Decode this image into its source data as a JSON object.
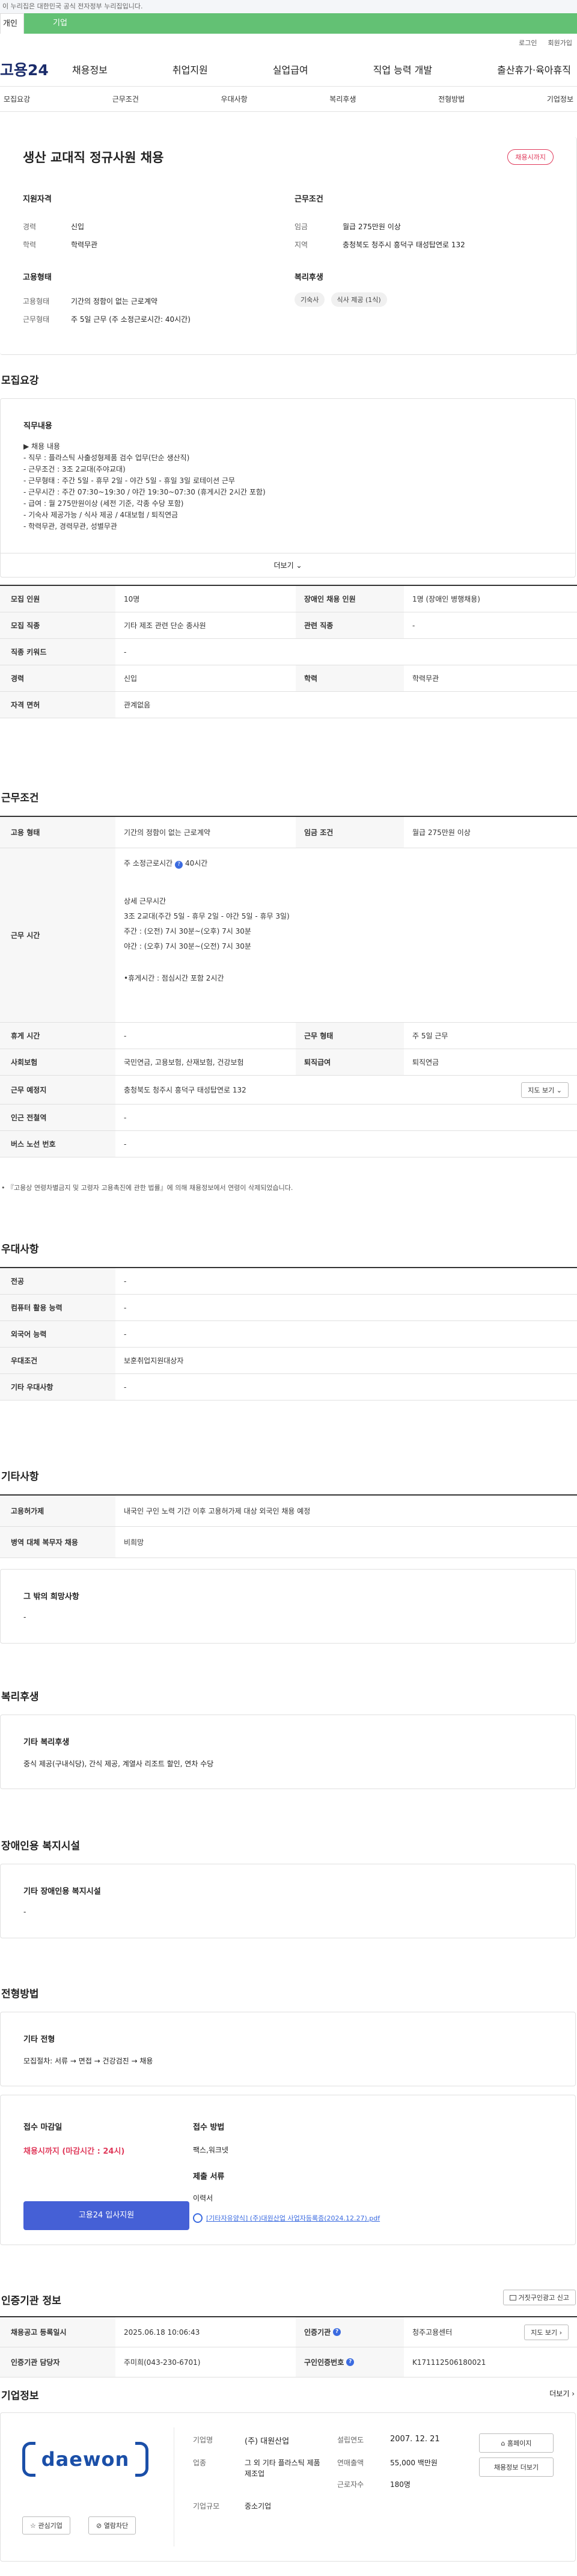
{
  "gov_banner": "이 누리집은 대한민국 공식 전자정부 누리집입니다.",
  "tabs": {
    "person": "개인",
    "company": "기업"
  },
  "util": {
    "login": "로그인",
    "join": "회원가입"
  },
  "logo": "고용24",
  "gnb": [
    "채용정보",
    "취업지원",
    "실업급여",
    "직업 능력 개발",
    "출산휴가·육아휴직"
  ],
  "subnav": [
    "모집요강",
    "근무조건",
    "우대사항",
    "복리후생",
    "전형방법",
    "기업정보"
  ],
  "summary": {
    "title": "생산 교대직 정규사원 채용",
    "badge": "채용시까지",
    "qualification_h": "지원자격",
    "career_l": "경력",
    "career_v": "신입",
    "edu_l": "학력",
    "edu_v": "학력무관",
    "emptype_h": "고용형태",
    "emptype_l": "고용형태",
    "emptype_v": "기간의 정함이 없는 근로계약",
    "worktype_l": "근무형태",
    "worktype_v": "주 5일 근무 (주 소정근로시간: 40시간)",
    "cond_h": "근무조건",
    "wage_l": "임금",
    "wage_v": "월급 275만원 이상",
    "region_l": "지역",
    "region_v": "충청북도 청주시 흥덕구 태성탑연로 132",
    "welfare_h": "복리후생",
    "welfare_pills": [
      "기숙사",
      "식사 제공 (1식)"
    ]
  },
  "req": {
    "heading": "모집요강",
    "job_h": "직무내용",
    "job_lines": [
      "▶ 채용 내용",
      "- 직무 : 플라스틱 사출성형제품 검수 업무(단순 생산직)",
      "- 근무조건 : 3조 2교대(주야교대)",
      "- 근무형태 : 주간 5일 - 휴무 2일 - 야간 5일 - 휴일 3일 로테이션 근무",
      "- 근무시간 : 주간 07:30~19:30 / 야간 19:30~07:30 (휴게시간 2시간 포함)",
      "- 급여 : 월 275만원이상 (세전 기준, 각종 수당 포함)",
      "- 기숙사 제공가능 / 식사 제공 / 4대보험 / 퇴직연금",
      "- 학력무관, 경력무관, 성별무관"
    ],
    "more": "더보기",
    "rows": [
      {
        "l1": "모집 인원",
        "v1": "10명",
        "l2": "장애인 채용 인원",
        "v2": "1명 (장애인 병행채용)"
      },
      {
        "l1": "모집 직종",
        "v1": "기타 제조 관련 단순 종사원",
        "l2": "관련 직종",
        "v2": "-"
      },
      {
        "l1": "직종 키워드",
        "v1": "-"
      },
      {
        "l1": "경력",
        "v1": "신입",
        "l2": "학력",
        "v2": "학력무관"
      },
      {
        "l1": "자격 면허",
        "v1": "관계없음"
      }
    ]
  },
  "work": {
    "heading": "근무조건",
    "emptype_l": "고용 형태",
    "emptype_v": "기간의 정함이 없는 근로계약",
    "wage_l": "임금 조건",
    "wage_v": "월급 275만원 이상",
    "time_l": "근무 시간",
    "time_lines": [
      "주 소정근로시간",
      "40시간",
      "상세 근무시간",
      "3조 2교대(주간 5일 - 휴무 2일 - 야간 5일 - 휴무 3일)",
      "주간 : (오전) 7시 30분~(오후) 7시 30분",
      "야간 : (오후) 7시 30분~(오전) 7시 30분",
      "•휴게시간 : 점심시간 포함 2시간"
    ],
    "rest_l": "휴게 시간",
    "rest_v": "-",
    "form_l": "근무 형태",
    "form_v": "주 5일 근무",
    "ins_l": "사회보험",
    "ins_v": "국민연금, 고용보험, 산재보험, 건강보험",
    "ret_l": "퇴직급여",
    "ret_v": "퇴직연금",
    "place_l": "근무 예정지",
    "place_v": "충청북도 청주시 흥덕구 태성탑연로 132",
    "map_btn": "지도 보기",
    "subway_l": "인근 전철역",
    "subway_v": "-",
    "bus_l": "버스 노선 번호",
    "bus_v": "-",
    "note": "• 『고용상 연령차별금지 및 고령자 고용촉진에 관한 법률』에 의해 채용정보에서 연령이 삭제되었습니다."
  },
  "pref": {
    "heading": "우대사항",
    "rows": [
      {
        "l": "전공",
        "v": "-"
      },
      {
        "l": "컴퓨터 활용 능력",
        "v": "-"
      },
      {
        "l": "외국어 능력",
        "v": "-"
      },
      {
        "l": "우대조건",
        "v": "보훈취업지원대상자"
      },
      {
        "l": "기타 우대사항",
        "v": "-"
      }
    ]
  },
  "etc": {
    "heading": "기타사항",
    "r1_l": "고용허가제",
    "r1_v": "내국인 구인 노력 기간 이후 고용허가제 대상 외국인 채용 예정",
    "r2_l": "병역 대체 복무자 채용",
    "r2_v": "비희망",
    "other_h": "그 밖의 희망사항",
    "other_v": "-"
  },
  "welfare": {
    "heading": "복리후생",
    "sub": "기타 복리후생",
    "text": "중식 제공(구내식당), 간식 제공, 계열사 리조트 할인, 연차 수당"
  },
  "disab": {
    "heading": "장애인용 복지시설",
    "sub": "기타 장애인용 복지시설",
    "text": "-"
  },
  "select": {
    "heading": "전형방법",
    "sub": "기타 전형",
    "text": "모집절차: 서류 → 면접 → 건강검진 → 채용",
    "deadline_h": "접수 마감일",
    "deadline_v": "채용시까지 (마감시간 : 24시)",
    "apply_btn": "고용24 입사지원",
    "method_h": "접수 방법",
    "method_v": "팩스,워크넷",
    "docs_h": "제출 서류",
    "docs_v": "이력서",
    "file": "[기타자유양식] (주)대원산업 사업자등록증(2024.12.27).pdf"
  },
  "agency": {
    "heading": "인증기관 정보",
    "report_btn": "거짓구인광고 신고",
    "r1_l1": "채용공고 등록일시",
    "r1_v1": "2025.06.18 10:06:43",
    "r1_l2": "인증기관",
    "r1_v2": "청주고용센터",
    "map_btn": "지도 보기",
    "r2_l1": "인증기관 담당자",
    "r2_v1": "주미희(043-230-6701)",
    "r2_l2": "구인인증번호",
    "r2_v2": "K171112506180021"
  },
  "company": {
    "heading": "기업정보",
    "more": "더보기",
    "logo_text": "daewon",
    "fav_btn": "관심기업",
    "block_btn": "열람차단",
    "name_l": "기업명",
    "name_v": "(주) 대원산업",
    "found_l": "설립연도",
    "found_v": "2007. 12. 21",
    "ind_l": "업종",
    "ind_v": "그 외 기타 플라스틱 제품 제조업",
    "sales_l": "연매출액",
    "sales_v": "55,000 백만원",
    "emp_l": "근로자수",
    "emp_v": "180명",
    "size_l": "기업규모",
    "size_v": "중소기업",
    "home_btn": "홈페이지",
    "jobs_btn": "채용정보 더보기"
  },
  "colors": {
    "accent": "#3b6be0",
    "green": "#63c174",
    "red": "#e03a5b",
    "apply": "#4560d6"
  }
}
